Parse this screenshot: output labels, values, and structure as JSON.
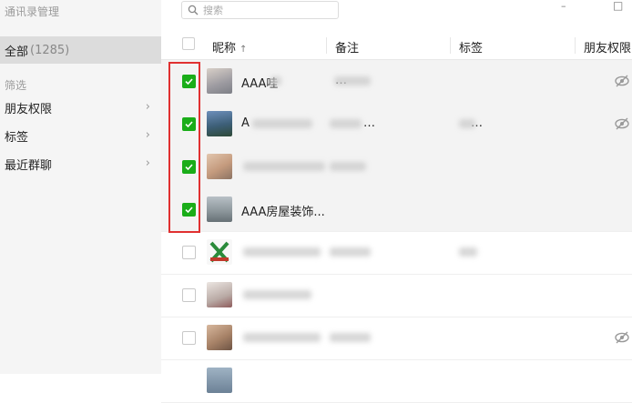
{
  "sidebar": {
    "title": "通讯录管理",
    "all_label": "全部",
    "all_count": "(1285)",
    "filter_label": "筛选",
    "items": [
      {
        "label": "朋友权限",
        "chevron": "›"
      },
      {
        "label": "标签",
        "chevron": "›"
      },
      {
        "label": "最近群聊",
        "chevron": "›"
      }
    ]
  },
  "search": {
    "placeholder": "搜索",
    "icon": "search-icon"
  },
  "window": {
    "minimize": "–",
    "maximize": "□"
  },
  "table": {
    "headers": {
      "nickname": "昵称",
      "sort": "↑",
      "remark": "备注",
      "tag": "标签",
      "permission": "朋友权限"
    },
    "rows": [
      {
        "checked": true,
        "nickname": "AAA哇",
        "remark": "…",
        "tag": ""
      },
      {
        "checked": true,
        "nickname": "A",
        "remark": "…",
        "tag": "…"
      },
      {
        "checked": true,
        "nickname": "",
        "remark": "",
        "tag": ""
      },
      {
        "checked": true,
        "nickname": "AAA房屋装饰...",
        "remark": "",
        "tag": ""
      },
      {
        "checked": false,
        "nickname": "",
        "remark": "",
        "tag": ""
      },
      {
        "checked": false,
        "nickname": "",
        "remark": "",
        "tag": ""
      },
      {
        "checked": false,
        "nickname": "",
        "remark": "",
        "tag": ""
      }
    ]
  },
  "colors": {
    "accent": "#1aad19",
    "highlight": "#e03030",
    "sidebar_bg": "#f5f5f5",
    "selected_bg": "#dcdcdc"
  }
}
